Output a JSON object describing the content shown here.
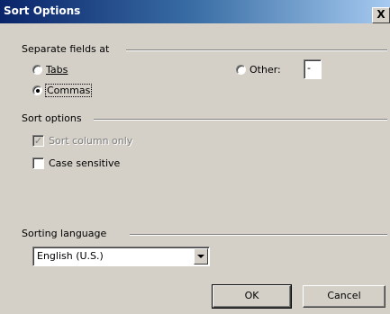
{
  "dialog": {
    "title": "Sort Options",
    "close_label": "X"
  },
  "separate_fields": {
    "group_label": "Separate fields at",
    "tabs_label": "Tabs",
    "tabs_selected": false,
    "commas_label": "Commas",
    "commas_selected": true,
    "other_label": "Other:",
    "other_selected": false,
    "other_value": "-"
  },
  "sort_options": {
    "group_label": "Sort options",
    "sort_column_only_label": "Sort column only",
    "sort_column_only_checked": true,
    "sort_column_only_disabled": true,
    "case_sensitive_label": "Case sensitive",
    "case_sensitive_checked": false
  },
  "sorting_language": {
    "group_label": "Sorting language",
    "selected": "English (U.S.)"
  },
  "buttons": {
    "ok": "OK",
    "cancel": "Cancel"
  },
  "colors": {
    "dialog_bg": "#d4d0c8",
    "titlebar_start": "#0a246a",
    "titlebar_end": "#a6caf0"
  }
}
